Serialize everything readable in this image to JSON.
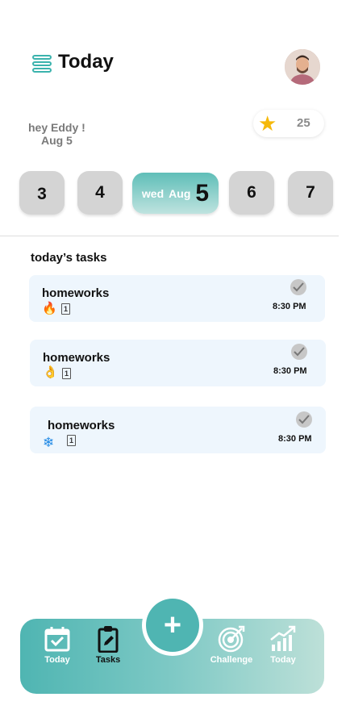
{
  "header": {
    "title": "Today"
  },
  "greeting": {
    "line1": "hey Eddy !",
    "line2": "Aug 5"
  },
  "stars": {
    "icon": "star-icon",
    "count": "25"
  },
  "days": [
    {
      "label": "3"
    },
    {
      "label": "4"
    },
    {
      "weekday": "wed",
      "month": "Aug",
      "day": "5",
      "selected": true
    },
    {
      "label": "6"
    },
    {
      "label": "7"
    }
  ],
  "tasks_section": {
    "title": "today’s tasks",
    "items": [
      {
        "title": "homeworks",
        "tag_icon": "fire-icon",
        "tag_glyph": "🔥",
        "cal_num": "1",
        "time": "8:30 PM"
      },
      {
        "title": "homeworks",
        "tag_icon": "ok-hand-icon",
        "tag_glyph": "👌",
        "cal_num": "1",
        "time": "8:30 PM"
      },
      {
        "title": "homeworks",
        "tag_icon": "snowflake-icon",
        "tag_glyph": "❄",
        "cal_num": "1",
        "time": "8:30 PM"
      }
    ]
  },
  "nav": {
    "add_label": "+",
    "items": [
      {
        "label": "Today",
        "icon": "calendar-check-icon"
      },
      {
        "label": "Tasks",
        "icon": "clipboard-edit-icon",
        "active": true
      },
      {
        "label": "Challenge",
        "icon": "target-icon"
      },
      {
        "label": "Today",
        "icon": "chart-growth-icon"
      }
    ]
  },
  "colors": {
    "accent": "#4fb5b2",
    "day_bg": "#d4d4d4",
    "task_bg": "#eef6fd",
    "star": "#f5b90b"
  }
}
